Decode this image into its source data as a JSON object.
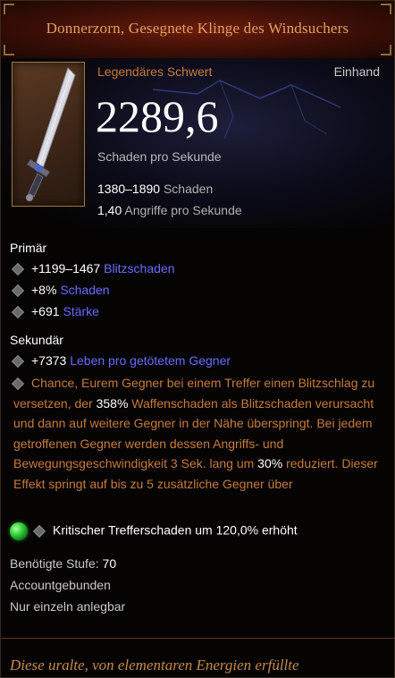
{
  "header": {
    "title": "Donnerzorn, Gesegnete Klinge des Windsuchers"
  },
  "item": {
    "type": "Legendäres Schwert",
    "slot": "Einhand",
    "icon": "sword-icon"
  },
  "stats": {
    "dps": "2289,6",
    "dps_label": "Schaden pro Sekunde",
    "damage_range": "1380–1890",
    "damage_label": "Schaden",
    "attack_speed": "1,40",
    "attack_speed_label": "Angriffe pro Sekunde"
  },
  "primary": {
    "label": "Primär",
    "affixes": [
      {
        "value": "+1199–1467",
        "text": "Blitzschaden"
      },
      {
        "value": "+8%",
        "text": "Schaden"
      },
      {
        "value": "+691",
        "text": "Stärke"
      }
    ]
  },
  "secondary": {
    "label": "Sekundär",
    "affixes": [
      {
        "value": "+7373",
        "text": "Leben pro getötetem Gegner"
      }
    ],
    "legendary": {
      "part1": "Chance, Eurem Gegner bei einem Treffer einen Blitzschlag zu versetzen, der ",
      "pct1": "358%",
      "part2": " Waffenschaden als Blitzschaden verursacht und dann auf weitere Gegner in der Nähe überspringt. Bei jedem getroffenen Gegner werden dessen Angriffs- und Bewegungsgeschwindigkeit 3 Sek. lang um ",
      "pct2": "30%",
      "part3": " reduziert. Dieser Effekt springt auf bis zu 5 zusätzliche Gegner über"
    }
  },
  "socket": {
    "gem_icon": "emerald-gem-icon",
    "text": "Kritischer Trefferschaden um 120,0% erhöht"
  },
  "requirements": {
    "level_label": "Benötigte Stufe: ",
    "level_value": "70",
    "bind": "Accountgebunden",
    "unique": "Nur einzeln anlegbar"
  },
  "flavor": {
    "text": "Diese uralte, von elementaren Energien erfüllte"
  },
  "colors": {
    "legendary": "#c87a3c",
    "title": "#e0a060",
    "affix_blue": "#6a6aff",
    "gem": "#3cd83c"
  }
}
